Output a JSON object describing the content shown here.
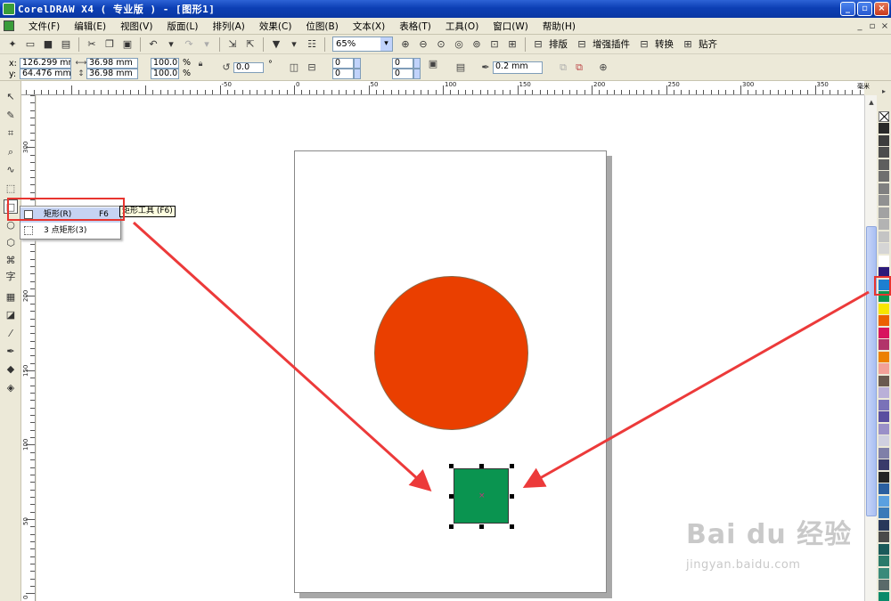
{
  "window": {
    "title": "CorelDRAW X4 ( 专业版 ) - [图形1]",
    "buttons": [
      "_",
      "▫",
      "×"
    ]
  },
  "menubar": {
    "items": [
      "文件(F)",
      "编辑(E)",
      "视图(V)",
      "版面(L)",
      "排列(A)",
      "效果(C)",
      "位图(B)",
      "文本(X)",
      "表格(T)",
      "工具(O)",
      "窗口(W)",
      "帮助(H)"
    ],
    "right_controls": [
      "_",
      "▫",
      "×"
    ]
  },
  "toolbar": {
    "zoom": "65%",
    "paiban": "排版",
    "zengqiang": "增强插件",
    "zhuanhuan": "转换",
    "tieqi": "贴齐"
  },
  "propbar": {
    "x_label": "x:",
    "x_value": "126.299 mm",
    "y_label": "y:",
    "y_value": "64.476 mm",
    "w_value": "36.98 mm",
    "h_value": "36.98 mm",
    "scale_x": "100.0",
    "scale_y": "100.0",
    "percent": "%",
    "angle": "0.0",
    "degree": "°",
    "corner1": "0",
    "corner2": "0",
    "corner3": "0",
    "corner4": "0",
    "outline": "0.2 mm"
  },
  "ruler": {
    "unit": "毫米",
    "h_labels": [
      "-50",
      "0",
      "50",
      "100",
      "150",
      "200",
      "250",
      "300",
      "350"
    ],
    "v_labels": [
      "300",
      "250",
      "200",
      "150",
      "100",
      "50",
      "0"
    ]
  },
  "flyout": {
    "item1_label": "矩形(R)",
    "item1_shortcut": "F6",
    "item2_label": "3 点矩形(3)",
    "tooltip": "矩形工具 (F6)"
  },
  "drawing": {
    "circle_color": "#ea3f00",
    "square_color": "#0a9450",
    "center_mark": "×"
  },
  "palette_colors": [
    "#2a2a2a",
    "#3d3d3d",
    "#4d4d4d",
    "#5e5e5e",
    "#6f6f6f",
    "#808080",
    "#919191",
    "#a2a2a2",
    "#b3b3b3",
    "#c4c4c4",
    "#d5d5d5",
    "#ffffff",
    "#2c1a7a",
    "#1e7fd0",
    "#0a9450",
    "#f7e600",
    "#ec6000",
    "#d8145e",
    "#b2336a",
    "#ec8000",
    "#f2a098",
    "#6a5a50",
    "#bab0d8",
    "#7a72b8",
    "#5a4ea0",
    "#9a90c8",
    "#d0d0e0",
    "#7f7fa8",
    "#3a3a6a",
    "#242424",
    "#2a5fa0",
    "#5aa0e0",
    "#3a7ab8",
    "#28385a",
    "#4a4a4a",
    "#1a5a5a",
    "#2a7a6a",
    "#3a8a7a",
    "#5a6a6a",
    "#0a8a6a"
  ],
  "watermark": {
    "brand": "Bai du 经验",
    "url": "jingyan.baidu.com"
  }
}
